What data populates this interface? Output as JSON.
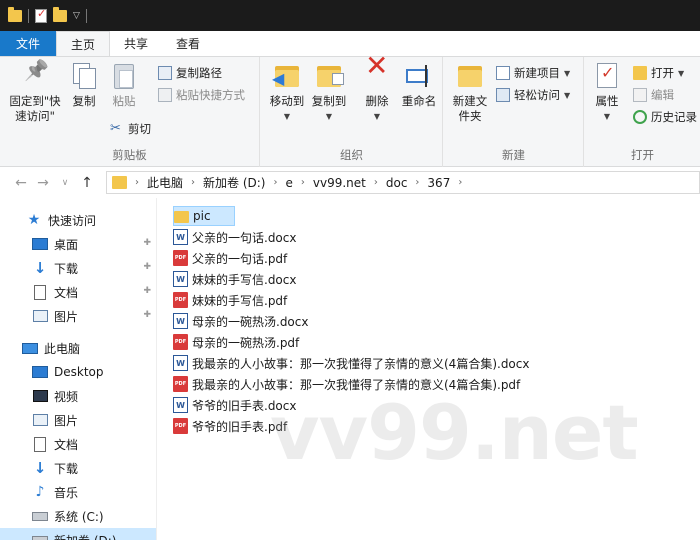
{
  "tabs": [
    {
      "label": "文件"
    },
    {
      "label": "主页"
    },
    {
      "label": "共享"
    },
    {
      "label": "查看"
    }
  ],
  "ribbon": {
    "clipboard": {
      "label": "剪贴板",
      "pin_label": "固定到\"快速访问\"",
      "copy_label": "复制",
      "paste_label": "粘贴",
      "copy_path": "复制路径",
      "paste_shortcut": "粘贴快捷方式",
      "cut": "剪切"
    },
    "organize": {
      "label": "组织",
      "move_to": "移动到",
      "copy_to": "复制到",
      "delete": "删除",
      "rename": "重命名"
    },
    "new": {
      "label": "新建",
      "new_folder": "新建文件夹",
      "new_item": "新建项目",
      "easy_access": "轻松访问"
    },
    "open": {
      "label": "打开",
      "properties": "属性",
      "open": "打开",
      "edit": "编辑",
      "history": "历史记录"
    }
  },
  "address": {
    "segments": [
      "此电脑",
      "新加卷 (D:)",
      "e",
      "vv99.net",
      "doc",
      "367"
    ]
  },
  "navpane": {
    "items": [
      {
        "label": "快速访问",
        "icon": "star-icon"
      },
      {
        "label": "桌面",
        "icon": "desktop-icon",
        "pinned": true
      },
      {
        "label": "下载",
        "icon": "download-icon",
        "pinned": true
      },
      {
        "label": "文档",
        "icon": "document-icon",
        "pinned": true
      },
      {
        "label": "图片",
        "icon": "picture-icon",
        "pinned": true
      },
      {
        "label": "此电脑",
        "icon": "computer-icon"
      },
      {
        "label": "Desktop",
        "icon": "desktop-icon"
      },
      {
        "label": "视频",
        "icon": "video-icon"
      },
      {
        "label": "图片",
        "icon": "picture-icon"
      },
      {
        "label": "文档",
        "icon": "document-icon"
      },
      {
        "label": "下载",
        "icon": "download-icon"
      },
      {
        "label": "音乐",
        "icon": "music-icon"
      },
      {
        "label": "系统 (C:)",
        "icon": "drive-icon"
      },
      {
        "label": "新加卷 (D:)",
        "icon": "drive-icon"
      }
    ]
  },
  "files": [
    {
      "name": "pic",
      "type": "folder"
    },
    {
      "name": "父亲的一句话.docx",
      "type": "word"
    },
    {
      "name": "父亲的一句话.pdf",
      "type": "pdf"
    },
    {
      "name": "妹妹的手写信.docx",
      "type": "word"
    },
    {
      "name": "妹妹的手写信.pdf",
      "type": "pdf"
    },
    {
      "name": "母亲的一碗热汤.docx",
      "type": "word"
    },
    {
      "name": "母亲的一碗热汤.pdf",
      "type": "pdf"
    },
    {
      "name": "我最亲的人小故事：那一次我懂得了亲情的意义(4篇合集).docx",
      "type": "word"
    },
    {
      "name": "我最亲的人小故事：那一次我懂得了亲情的意义(4篇合集).pdf",
      "type": "pdf"
    },
    {
      "name": "爷爷的旧手表.docx",
      "type": "word"
    },
    {
      "name": "爷爷的旧手表.pdf",
      "type": "pdf"
    }
  ],
  "watermark": "vv99.net",
  "colors": {
    "accent": "#1979ca",
    "selection": "#cce8ff",
    "folder": "#f3c64c",
    "pdf": "#d93a3a",
    "word": "#2b5797"
  }
}
